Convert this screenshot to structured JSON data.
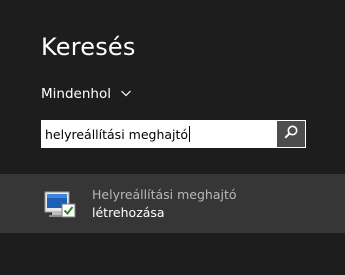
{
  "header": {
    "title": "Keresés"
  },
  "scope": {
    "label": "Mindenhol",
    "icon": "chevron-down-icon"
  },
  "search": {
    "value": "helyreállítási meghajtó",
    "button_icon": "search-icon"
  },
  "results": [
    {
      "line1": "Helyreállítási meghajtó",
      "line2": "létrehozása",
      "icon": "recovery-drive-icon"
    }
  ],
  "colors": {
    "background": "#1d1d1d",
    "result_highlight": "#363636",
    "search_button": "#4d4d4d"
  }
}
